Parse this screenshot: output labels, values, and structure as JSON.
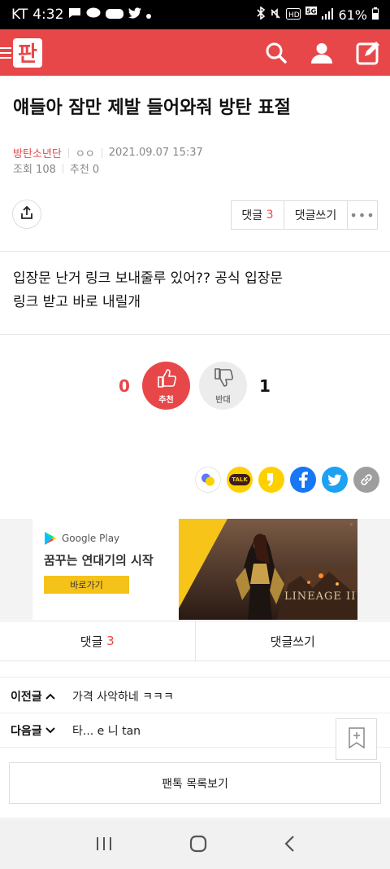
{
  "status_bar": {
    "carrier": "KT",
    "time": "4:32",
    "battery": "61%"
  },
  "header": {
    "logo_text": "판"
  },
  "post": {
    "title": "얘들아 잠만 제발 들어와줘 방탄 표절",
    "author": "방탄소년단",
    "author_sub": "ㅇㅇ",
    "datetime": "2021.09.07 15:37",
    "views_label": "조회 108",
    "recommend_label": "추천 0",
    "body_line1": "입장문 난거 링크 보내줄루 있어?? 공식 입장문",
    "body_line2": "링크 받고 바로 내릴개"
  },
  "actions": {
    "comment_label": "댓글",
    "comment_count": "3",
    "write_comment_label": "댓글쓰기",
    "more_label": "•••"
  },
  "votes": {
    "up_count": "0",
    "up_label": "추천",
    "down_label": "반대",
    "down_count": "1"
  },
  "share": {
    "kakaotalk_label": "TALK"
  },
  "ad": {
    "store_label": "Google Play",
    "headline": "꿈꾸는 연대기의 시작",
    "button_label": "바로가기",
    "brand_text": "LINEAGE II"
  },
  "bottom_bar": {
    "comment_label": "댓글",
    "comment_count": "3",
    "write_label": "댓글쓰기"
  },
  "nav": {
    "prev_label": "이전글",
    "prev_title": "가격 사악하네 ㅋㅋㅋ",
    "next_label": "다음글",
    "next_title": "타... e 니 tan"
  },
  "list_button_label": "팬톡 목록보기",
  "colors": {
    "brand": "#e8474a",
    "kakao_yellow": "#ffd000",
    "facebook": "#1877f2",
    "twitter": "#1da1f2",
    "link_gray": "#9e9e9e"
  }
}
